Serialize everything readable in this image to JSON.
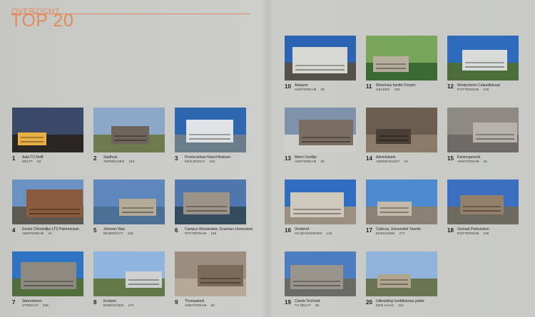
{
  "header": {
    "kicker": "OVERZICHT",
    "title": "TOP 20"
  },
  "items": [
    {
      "rank": "1",
      "name": "Aula TU Delft",
      "city": "DELFT",
      "count": "82",
      "colors": {
        "sky": "#3a4a66",
        "ground": "#2a2622",
        "accent": "#e8b044"
      }
    },
    {
      "rank": "2",
      "name": "Stadhuis",
      "city": "TERNEUZEN",
      "count": "160",
      "colors": {
        "sky": "#8da7c8",
        "ground": "#6f7a4f",
        "accent": "#6d655c"
      }
    },
    {
      "rank": "3",
      "name": "Provinciehuis Noord-Brabant",
      "city": "DEN BOSCH",
      "count": "162",
      "colors": {
        "sky": "#2f66b0",
        "ground": "#6a7d8a",
        "accent": "#dfe2e4"
      }
    },
    {
      "rank": "4",
      "name": "Eerste Christelijke LTS Patrimonium",
      "city": "AMSTERDAM",
      "count": "34",
      "colors": {
        "sky": "#6a93c4",
        "ground": "#5e5a52",
        "accent": "#8a5b3c"
      }
    },
    {
      "rank": "5",
      "name": "Johnson Wax",
      "city": "MIJDRECHT",
      "count": "238",
      "colors": {
        "sky": "#5e87be",
        "ground": "#4c6f95",
        "accent": "#b4aa98"
      }
    },
    {
      "rank": "6",
      "name": "Campus Woudestein, Erasmus Universiteit",
      "city": "ROTTERDAM",
      "count": "130",
      "colors": {
        "sky": "#4d77ad",
        "ground": "#344b5e",
        "accent": "#9c9488"
      }
    },
    {
      "rank": "7",
      "name": "Sterrentoren",
      "city": "UTRECHT",
      "count": "345",
      "colors": {
        "sky": "#2e74c2",
        "ground": "#4f6e3c",
        "accent": "#8e8a82"
      }
    },
    {
      "rank": "8",
      "name": "Evoluon",
      "city": "EINDHOVEN",
      "count": "174",
      "colors": {
        "sky": "#8fb4de",
        "ground": "#617a47",
        "accent": "#cfd1d0"
      }
    },
    {
      "rank": "9",
      "name": "Thomaskerk",
      "city": "AMSTERDAM",
      "count": "64",
      "colors": {
        "sky": "#9c8e7e",
        "ground": "#b5a995",
        "accent": "#7a6a58"
      }
    },
    {
      "rank": "10",
      "name": "Autopon",
      "city": "AMSTERDAM",
      "count": "28",
      "colors": {
        "sky": "#2c63b3",
        "ground": "#56504a",
        "accent": "#d8d8d2"
      }
    },
    {
      "rank": "11",
      "name": "Woonhuis familie Poryert",
      "city": "GELEEN",
      "count": "180",
      "colors": {
        "sky": "#79a55a",
        "ground": "#3c6a34",
        "accent": "#b6ae9c"
      }
    },
    {
      "rank": "12",
      "name": "Windscherm Calandkanaal",
      "city": "ROTTERDAM",
      "count": "126",
      "colors": {
        "sky": "#2f6bbd",
        "ground": "#4c6e3b",
        "accent": "#d9dbd8"
      }
    },
    {
      "rank": "13",
      "name": "Metro Oostlijn",
      "city": "AMSTERDAM",
      "count": "50",
      "colors": {
        "sky": "#7e93ab",
        "ground": "#cfd0cc",
        "accent": "#7a6e62"
      }
    },
    {
      "rank": "14",
      "name": "Adventskerk",
      "city": "AERDENHOUT",
      "count": "24",
      "colors": {
        "sky": "#6b5d50",
        "ground": "#8c7b69",
        "accent": "#4a4038"
      }
    },
    {
      "rank": "15",
      "name": "Kantongerecht",
      "city": "AMSTERDAM",
      "count": "44",
      "colors": {
        "sky": "#8d8a84",
        "ground": "#6e6b66",
        "accent": "#b6b3ad"
      }
    },
    {
      "rank": "16",
      "name": "Vredehof",
      "city": "SCHEVENINGEN",
      "count": "132",
      "colors": {
        "sky": "#2f6dc0",
        "ground": "#9a8f80",
        "accent": "#cfc9bd"
      }
    },
    {
      "rank": "17",
      "name": "Cubicus, Universiteit Twente",
      "city": "ENSCHEDE",
      "count": "277",
      "colors": {
        "sky": "#4d8ad0",
        "ground": "#8a8074",
        "accent": "#c2b9aa"
      }
    },
    {
      "rank": "18",
      "name": "Gemaal Parksluizen",
      "city": "ROTTERDAM",
      "count": "125",
      "colors": {
        "sky": "#3b6fbf",
        "ground": "#6d6a62",
        "accent": "#93806a"
      }
    },
    {
      "rank": "19",
      "name": "Civiele Techniek",
      "city": "TU DELFT",
      "count": "96",
      "colors": {
        "sky": "#4b7dc0",
        "ground": "#6a6a64",
        "accent": "#9a958c"
      }
    },
    {
      "rank": "20",
      "name": "Uitbreiding hoofdbureau politie",
      "city": "DEN HAAG",
      "count": "112",
      "colors": {
        "sky": "#8fb3da",
        "ground": "#6a7452",
        "accent": "#b1a590"
      }
    }
  ]
}
